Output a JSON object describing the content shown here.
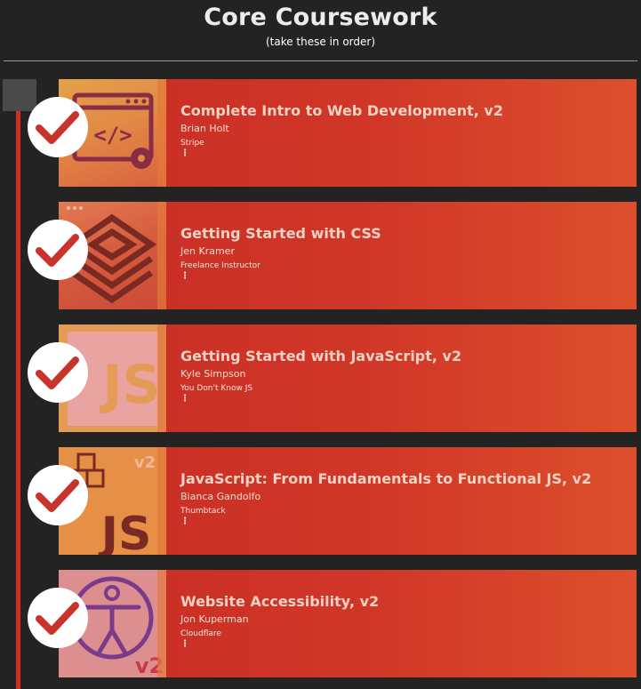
{
  "header": {
    "title": "Core Coursework",
    "subtitle": "(take these in order)"
  },
  "colors": {
    "background": "#232323",
    "accent": "#cf2e22",
    "card_start": "#c82c24",
    "card_end": "#dc4f2c",
    "check": "#c8332c"
  },
  "courses": [
    {
      "title": "Complete Intro to Web Development, v2",
      "author": "Brian Holt",
      "company": "Stripe",
      "more": "⋮",
      "completed": true,
      "thumbnail_icon": "code-window-icon"
    },
    {
      "title": "Getting Started with CSS",
      "author": "Jen Kramer",
      "company": "Freelance Instructor",
      "more": "⋮",
      "completed": true,
      "thumbnail_icon": "css-layers-icon"
    },
    {
      "title": "Getting Started with JavaScript, v2",
      "author": "Kyle Simpson",
      "company": "You Don't Know JS",
      "more": "⋮",
      "completed": true,
      "thumbnail_icon": "js-logo-icon"
    },
    {
      "title": "JavaScript: From Fundamentals to Functional JS, v2",
      "author": "Bianca Gandolfo",
      "company": "Thumbtack",
      "more": "⋮",
      "completed": true,
      "thumbnail_icon": "js-blocks-v2-icon",
      "thumbnail_text": "JS",
      "thumbnail_badge": "v2"
    },
    {
      "title": "Website Accessibility, v2",
      "author": "Jon Kuperman",
      "company": "Cloudflare",
      "more": "⋮",
      "completed": true,
      "thumbnail_icon": "accessibility-figure-icon",
      "thumbnail_badge": "v2"
    }
  ]
}
